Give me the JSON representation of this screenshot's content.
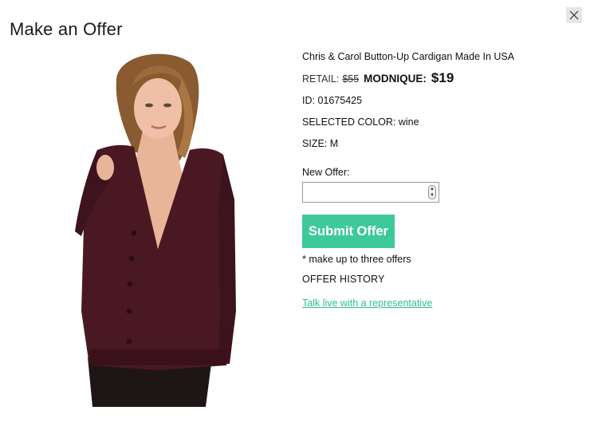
{
  "modal": {
    "title": "Make an Offer",
    "close_label": "X"
  },
  "product": {
    "name": "Chris & Carol Button-Up Cardigan Made In USA",
    "retail_label": "RETAIL:",
    "retail_price": "$55",
    "modnique_label": "MODNIQUE:",
    "modnique_price": "$19",
    "id_text": "ID: 01675425",
    "color_text": "SELECTED COLOR: wine",
    "size_text": "SIZE: M",
    "image_alt": "model wearing wine button-up cardigan"
  },
  "offer": {
    "label": "New Offer:",
    "value": "",
    "placeholder": "",
    "submit_label": "Submit Offer",
    "note": "* make up to three offers",
    "history_label": "OFFER HISTORY"
  },
  "support": {
    "link_text": "Talk live with a representative"
  },
  "colors": {
    "accent": "#3ec999",
    "link": "#2fbf8f",
    "cardigan": "#4a1823"
  },
  "icons": {
    "close": "close-icon",
    "spinner_up": "chevron-up-icon",
    "spinner_down": "chevron-down-icon"
  }
}
